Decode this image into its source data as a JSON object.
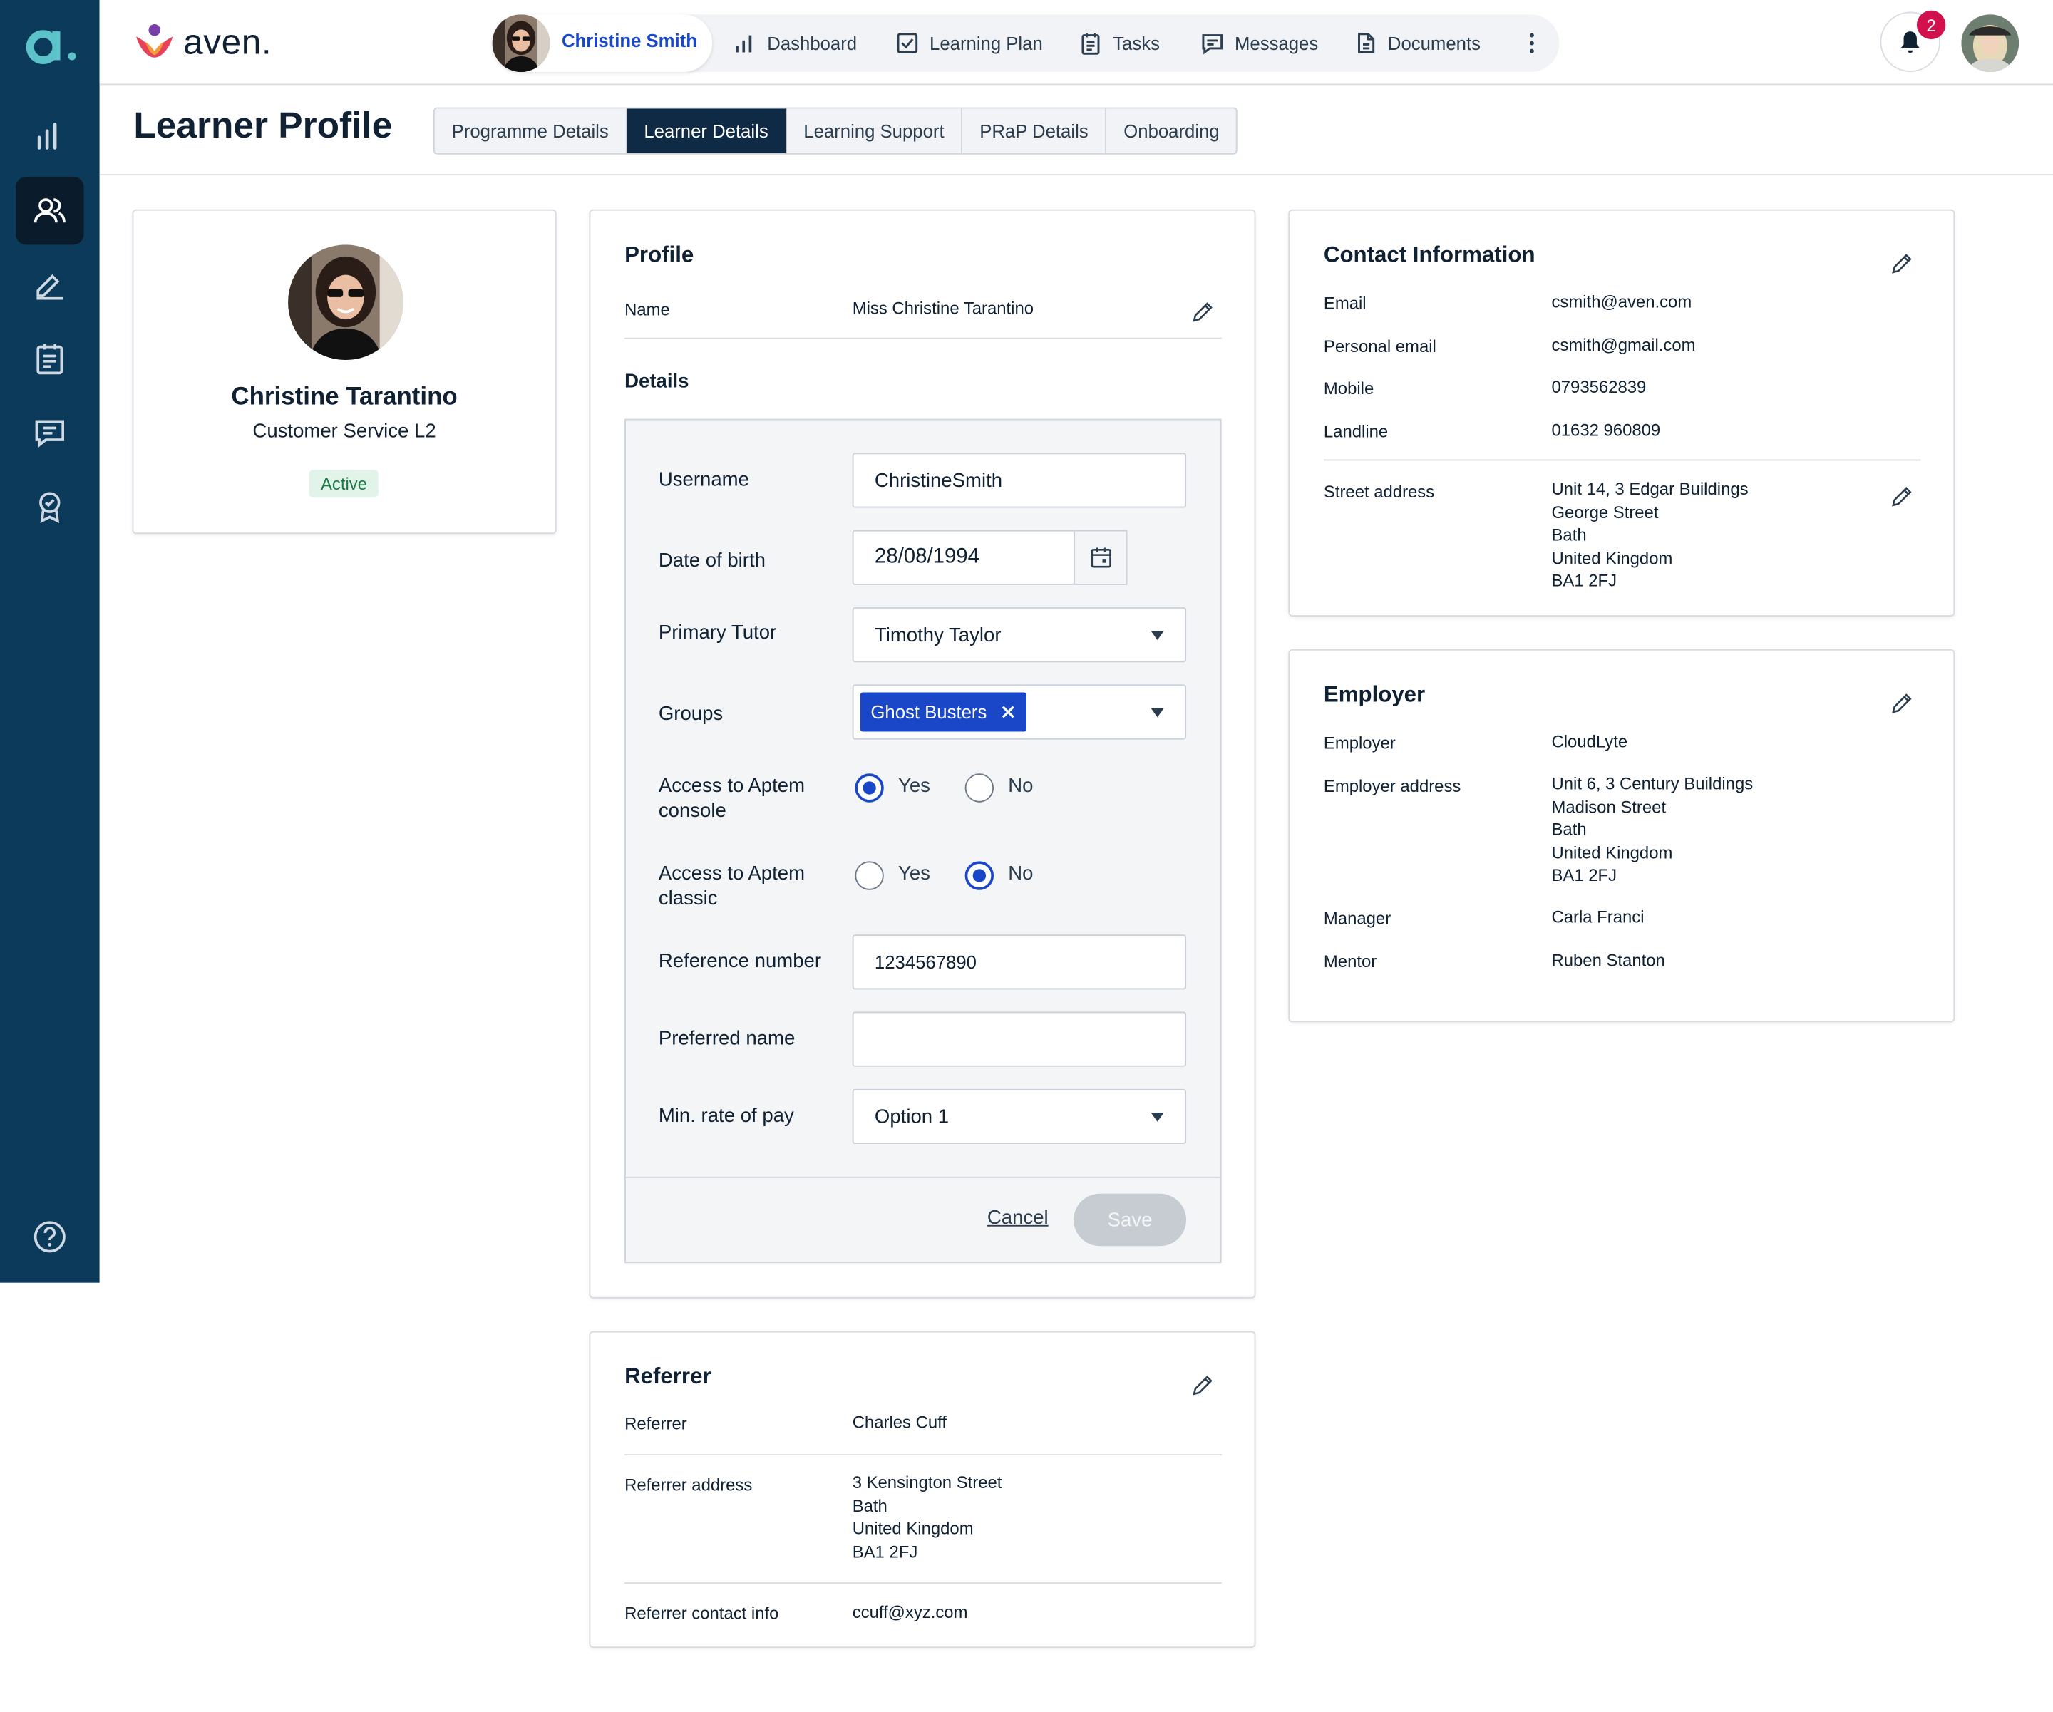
{
  "colors": {
    "rail": "#0c3a5a",
    "accent": "#1947c8",
    "active_tab": "#0f2a44",
    "badge": "#d1104e"
  },
  "brand": {
    "name": "aven."
  },
  "topnav": {
    "user_name": "Christine Smith",
    "items": [
      "Dashboard",
      "Learning Plan",
      "Tasks",
      "Messages",
      "Documents"
    ],
    "notification_count": "2"
  },
  "page": {
    "title": "Learner Profile",
    "tabs": [
      "Programme Details",
      "Learner Details",
      "Learning Support",
      "PRaP Details",
      "Onboarding"
    ],
    "active_tab": "Learner Details"
  },
  "learner": {
    "name": "Christine Tarantino",
    "role": "Customer Service L2",
    "status": "Active"
  },
  "profile": {
    "title": "Profile",
    "name_label": "Name",
    "name_value": "Miss Christine Tarantino",
    "details_title": "Details",
    "form": {
      "username_label": "Username",
      "username": "ChristineSmith",
      "dob_label": "Date of birth",
      "dob": "28/08/1994",
      "tutor_label": "Primary Tutor",
      "tutor": "Timothy Taylor",
      "groups_label": "Groups",
      "group_chip": "Ghost Busters",
      "console_label": "Access to Aptem console",
      "console_value": "Yes",
      "classic_label": "Access to Aptem classic",
      "classic_value": "No",
      "yes": "Yes",
      "no": "No",
      "ref_label": "Reference number",
      "ref": "1234567890",
      "pref_label": "Preferred name",
      "pref": "",
      "pay_label": "Min. rate of pay",
      "pay": "Option 1",
      "cancel": "Cancel",
      "save": "Save"
    }
  },
  "contact": {
    "title": "Contact Information",
    "email_label": "Email",
    "email": "csmith@aven.com",
    "personal_email_label": "Personal email",
    "personal_email": "csmith@gmail.com",
    "mobile_label": "Mobile",
    "mobile": "0793562839",
    "landline_label": "Landline",
    "landline": "01632 960809",
    "address_label": "Street address",
    "address": [
      "Unit 14, 3 Edgar Buildings",
      "George Street",
      "Bath",
      "United Kingdom",
      "BA1 2FJ"
    ]
  },
  "employer": {
    "title": "Employer",
    "employer_label": "Employer",
    "employer": "CloudLyte",
    "address_label": "Employer address",
    "address": [
      "Unit 6, 3 Century Buildings",
      "Madison Street",
      "Bath",
      "United Kingdom",
      "BA1 2FJ"
    ],
    "manager_label": "Manager",
    "manager": "Carla Franci",
    "mentor_label": "Mentor",
    "mentor": "Ruben Stanton"
  },
  "referrer": {
    "title": "Referrer",
    "referrer_label": "Referrer",
    "referrer": "Charles Cuff",
    "address_label": "Referrer address",
    "address": [
      "3 Kensington Street",
      "Bath",
      "United Kingdom",
      "BA1 2FJ"
    ],
    "contact_label": "Referrer contact info",
    "contact": "ccuff@xyz.com"
  }
}
